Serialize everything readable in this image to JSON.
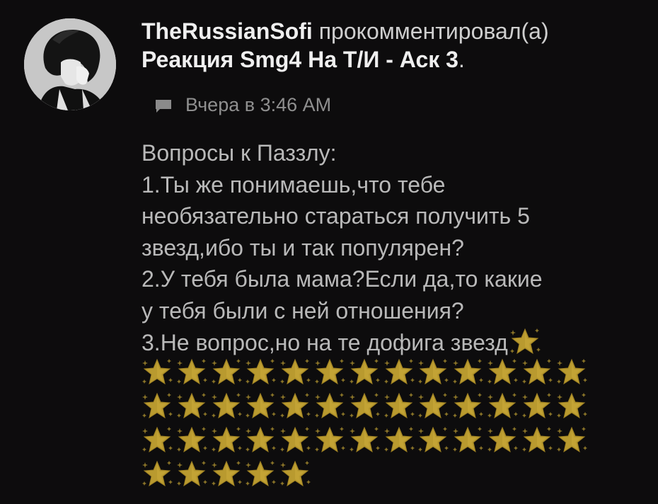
{
  "comment": {
    "username": "TheRussianSofi",
    "action": "прокомментировал(а)",
    "post_title": "Реакция Smg4 На Т/И - Аск 3",
    "post_title_suffix": ".",
    "timestamp": "Вчера в 3:46 AM",
    "body_lines": [
      "Вопросы к Паззлу:",
      "1.Ты же понимаешь,что тебе",
      "необязательно стараться получить 5",
      "звезд,ибо ты и так популярен?",
      "2.У тебя была мама?Если да,то какие",
      "у тебя были с ней отношения?",
      "3.Не вопрос,но на те дофига звезд"
    ],
    "star_rows": [
      13,
      13,
      13,
      5
    ],
    "icons": {
      "meta": "comment-icon",
      "avatar": "avatar",
      "emoji": "glowing-star-emoji"
    }
  }
}
